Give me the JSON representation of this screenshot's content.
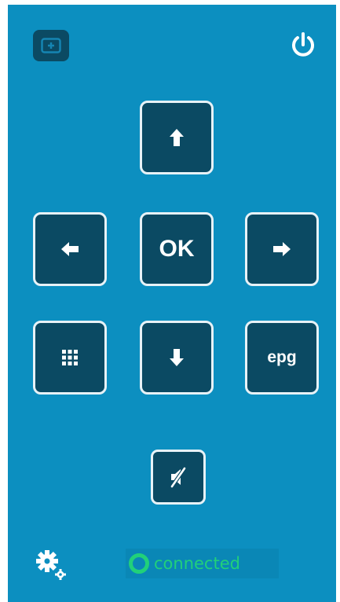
{
  "remote": {
    "tv_button": {
      "icon": "tv-icon"
    },
    "power_button": {
      "icon": "power-icon"
    },
    "dpad": {
      "up": {
        "icon": "arrow-up-icon"
      },
      "left": {
        "icon": "arrow-left-icon"
      },
      "ok": {
        "label": "OK"
      },
      "right": {
        "icon": "arrow-right-icon"
      },
      "numpad": {
        "icon": "grid-icon"
      },
      "down": {
        "icon": "arrow-down-icon"
      },
      "epg": {
        "label": "epg"
      }
    },
    "mute_button": {
      "icon": "mute-icon"
    },
    "settings_button": {
      "icon": "gear-icon"
    }
  },
  "status": {
    "text": "connected",
    "color": "#21d07a"
  },
  "colors": {
    "background": "#0c8fc0",
    "button_fill": "#0b4a63",
    "button_border": "#e7f2f7"
  }
}
